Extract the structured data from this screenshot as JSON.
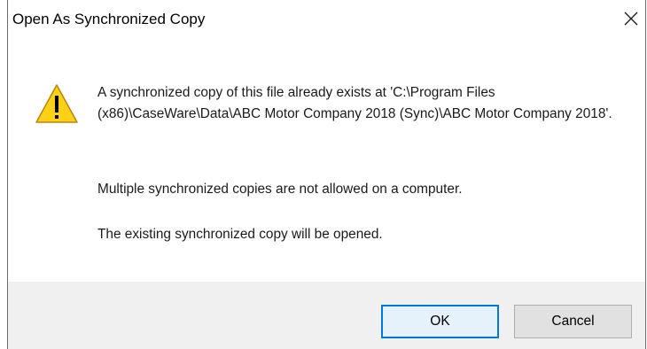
{
  "dialog": {
    "title": "Open As Synchronized Copy",
    "close_icon": "close-icon",
    "warning_icon": "warning-triangle-icon",
    "messages": {
      "existing_location": "A synchronized copy of this file already exists at 'C:\\Program Files (x86)\\CaseWare\\Data\\ABC Motor Company 2018 (Sync)\\ABC Motor Company 2018'.",
      "not_allowed": "Multiple synchronized copies are not allowed on a computer.",
      "will_open": "The existing synchronized copy will be opened."
    },
    "buttons": {
      "ok_label": "OK",
      "cancel_label": "Cancel"
    },
    "colors": {
      "footer_bg": "#f0f0f0",
      "default_button_border": "#0078d7",
      "warning_fill": "#fcd116"
    }
  }
}
